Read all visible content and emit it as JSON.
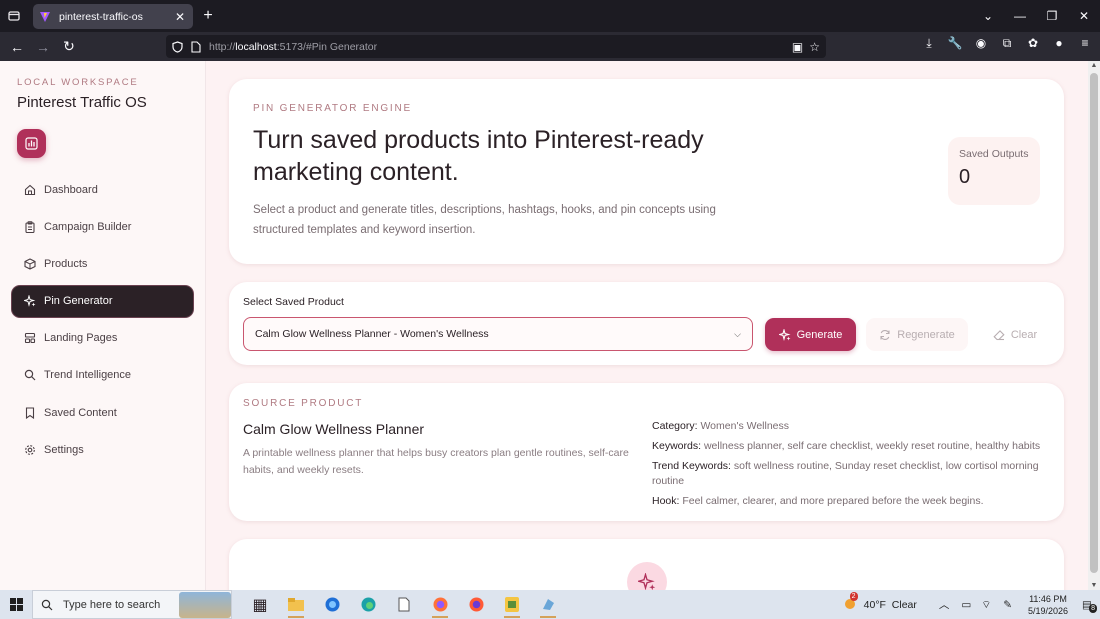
{
  "browser": {
    "tab_title": "pinterest-traffic-os",
    "url_prefix": "http://",
    "url_host": "localhost",
    "url_rest": ":5173/#Pin Generator"
  },
  "sidebar": {
    "workspace_label": "LOCAL WORKSPACE",
    "workspace_title": "Pinterest Traffic OS",
    "items": [
      {
        "label": "Dashboard",
        "icon": "home-icon"
      },
      {
        "label": "Campaign Builder",
        "icon": "clipboard-icon"
      },
      {
        "label": "Products",
        "icon": "box-icon"
      },
      {
        "label": "Pin Generator",
        "icon": "sparkles-icon",
        "active": true
      },
      {
        "label": "Landing Pages",
        "icon": "layout-icon"
      },
      {
        "label": "Trend Intelligence",
        "icon": "search-icon"
      },
      {
        "label": "Saved Content",
        "icon": "bookmark-icon"
      },
      {
        "label": "Settings",
        "icon": "gear-icon"
      }
    ]
  },
  "hero": {
    "eyebrow": "PIN GENERATOR ENGINE",
    "title": "Turn saved products into Pinterest-ready marketing content.",
    "description": "Select a product and generate titles, descriptions, hashtags, hooks, and pin concepts using structured templates and keyword insertion.",
    "saved_outputs_label": "Saved Outputs",
    "saved_outputs_value": "0"
  },
  "selector": {
    "label": "Select Saved Product",
    "selected": "Calm Glow Wellness Planner - Women's Wellness",
    "generate": "Generate",
    "regenerate": "Regenerate",
    "clear": "Clear"
  },
  "source": {
    "eyebrow": "SOURCE PRODUCT",
    "name": "Calm Glow Wellness Planner",
    "description": "A printable wellness planner that helps busy creators plan gentle routines, self-care habits, and weekly resets.",
    "category_label": "Category:",
    "category": "Women's Wellness",
    "keywords_label": "Keywords:",
    "keywords": "wellness planner, self care checklist, weekly reset routine, healthy habits",
    "trend_label": "Trend Keywords:",
    "trend": "soft wellness routine, Sunday reset checklist, low cortisol morning routine",
    "hook_label": "Hook:",
    "hook": "Feel calmer, clearer, and more prepared before the week begins."
  },
  "taskbar": {
    "search_placeholder": "Type here to search",
    "weather": "40°F  Clear",
    "weather_badge": "2",
    "time": "11:46 PM",
    "date": "5/19/2026",
    "notif_count": "8"
  },
  "colors": {
    "accent": "#b0305a",
    "dark": "#2b2126"
  }
}
